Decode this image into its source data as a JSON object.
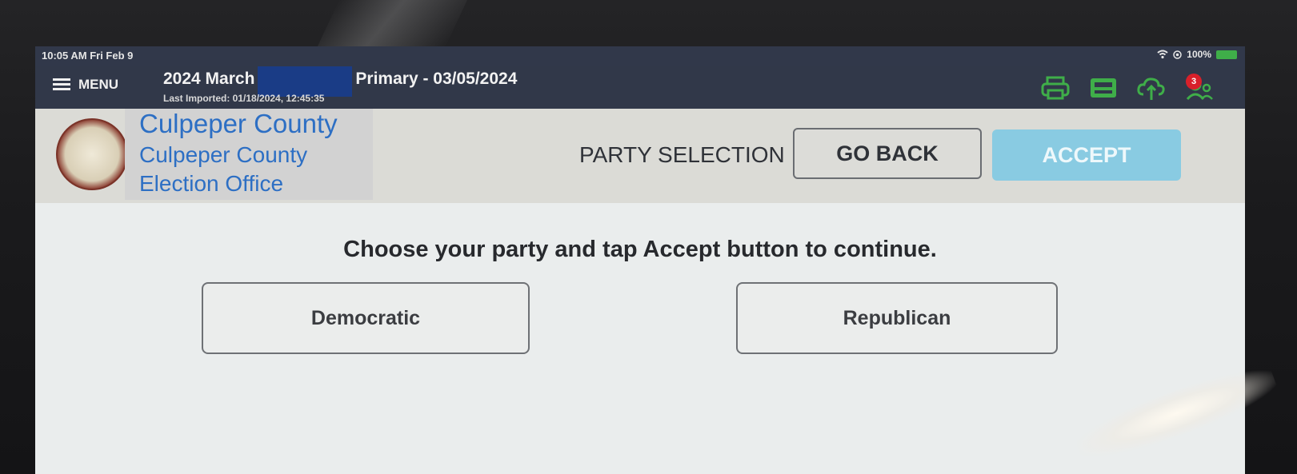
{
  "status_bar": {
    "time": "10:05 AM  Fri Feb 9",
    "battery": "100%",
    "icons": [
      "wifi-icon",
      "location-icon",
      "battery-icon"
    ]
  },
  "app_bar": {
    "menu_label": "MENU",
    "election_title_prefix": "2024 March",
    "election_title_suffix": "Primary - 03/05/2024",
    "last_imported": "Last Imported: 01/18/2024, 12:45:35",
    "icons": [
      "printer-icon",
      "scanner-icon",
      "cloud-sync-icon",
      "users-icon"
    ],
    "notification_count": "3",
    "icon_color": "#3fae49"
  },
  "header": {
    "county_name": "Culpeper County",
    "office_line1": "Culpeper County",
    "office_line2": "Election Office",
    "page_title": "PARTY SELECTION",
    "go_back_label": "GO BACK",
    "accept_label": "ACCEPT",
    "accept_color": "#89cbe2"
  },
  "main": {
    "instruction": "Choose your party and tap Accept button to continue.",
    "parties": [
      "Democratic",
      "Republican"
    ]
  }
}
